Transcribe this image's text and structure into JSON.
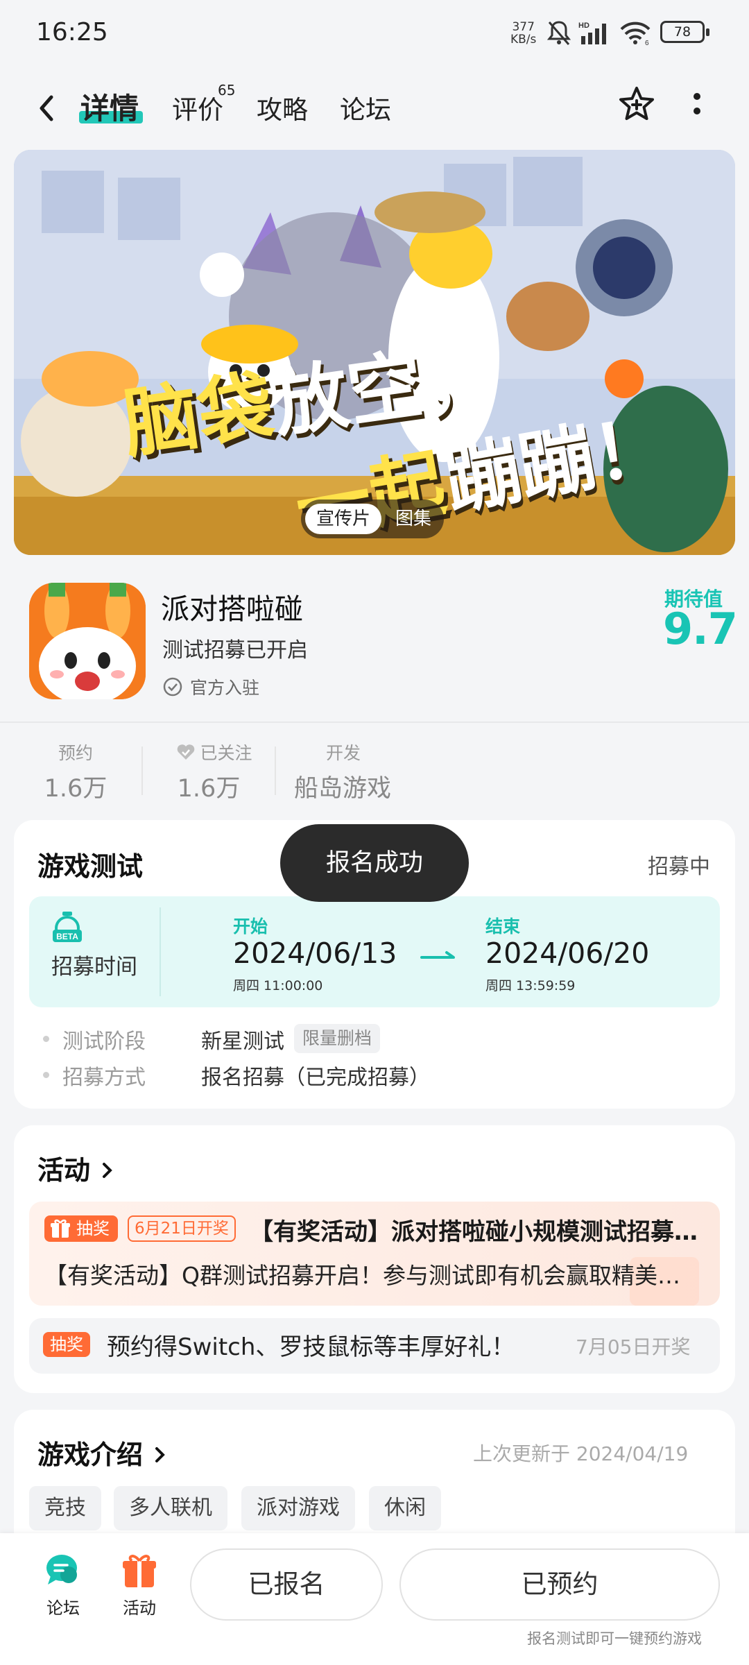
{
  "status_bar": {
    "time": "16:25",
    "net_speed_value": "377",
    "net_speed_unit": "KB/s",
    "signal_label": "HD",
    "wifi_label": "6",
    "battery": "78"
  },
  "nav": {
    "tabs": [
      {
        "label": "详情"
      },
      {
        "label": "评价",
        "count": "65"
      },
      {
        "label": "攻略"
      },
      {
        "label": "论坛"
      }
    ]
  },
  "hero": {
    "banner_text": "脑袋放空，一起蹦蹦！",
    "media_tabs": [
      "宣传片",
      "图集"
    ]
  },
  "game": {
    "name": "派对搭啦碰",
    "subtitle": "测试招募已开启",
    "official": "官方入驻",
    "expect_label": "期待值",
    "expect_score": "9.7"
  },
  "stats": [
    {
      "label": "预约",
      "value": "1.6万"
    },
    {
      "label": "已关注",
      "value": "1.6万"
    },
    {
      "label": "开发",
      "value": "船岛游戏"
    }
  ],
  "test_card": {
    "title": "游戏测试",
    "status": "招募中",
    "toast": "报名成功",
    "beta_icon_text": "BETA",
    "recruit_time_label": "招募时间",
    "start_label": "开始",
    "start_date": "2024/06/13",
    "start_time": "周四  11:00:00",
    "end_label": "结束",
    "end_date": "2024/06/20",
    "end_time": "周四  13:59:59",
    "rows": [
      {
        "label": "测试阶段",
        "value": "新星测试",
        "tag": "限量删档"
      },
      {
        "label": "招募方式",
        "value": "报名招募（已完成招募）"
      }
    ]
  },
  "activity_card": {
    "title": "活动",
    "item1": {
      "badge": "抽奖",
      "date_badge": "6月21日开奖",
      "title": "【有奖活动】派对搭啦碰小规模测试招募开启，参与即有机会",
      "desc": "【有奖活动】Q群测试招募开启！参与测试即有机会赢取精美周边"
    },
    "item2": {
      "badge": "抽奖",
      "text": "预约得Switch、罗技鼠标等丰厚好礼！",
      "date": "7月05日开奖"
    }
  },
  "intro_card": {
    "title": "游戏介绍",
    "updated": "上次更新于 2024/04/19",
    "tags": [
      "竞技",
      "多人联机",
      "派对游戏",
      "休闲"
    ]
  },
  "bottom_bar": {
    "forum_label": "论坛",
    "activity_label": "活动",
    "registered_button": "已报名",
    "reserved_button": "已预约",
    "hint": "报名测试即可一键预约游戏"
  },
  "colors": {
    "accent": "#19c4b4",
    "orange": "#ff6b35",
    "toast_bg": "#2b2b2b"
  }
}
